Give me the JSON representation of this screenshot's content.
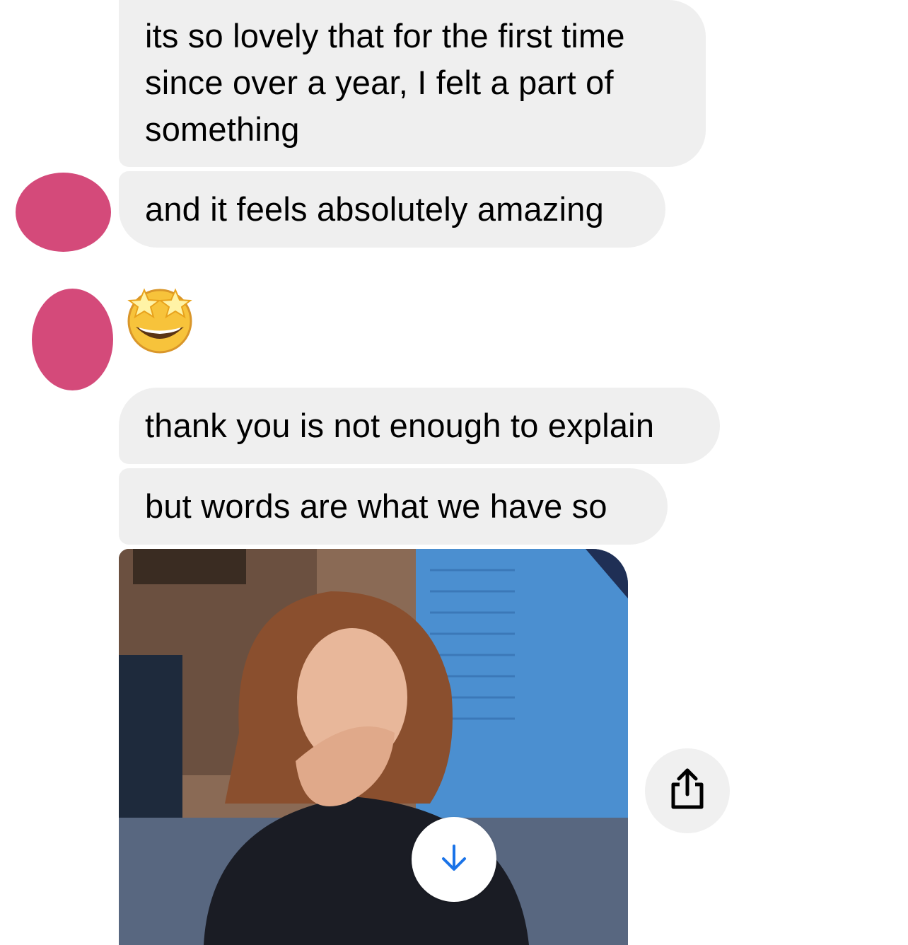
{
  "messages": [
    {
      "text": "its so lovely that for the first time since over a year, I felt a part of something"
    },
    {
      "text": "and it feels absolutely amazing"
    },
    {
      "emoji": "star-struck"
    },
    {
      "text": "thank you is not enough to explain"
    },
    {
      "text": "but words are what we have so"
    }
  ],
  "gif": {
    "subject": "woman blowing a kiss"
  },
  "icons": {
    "download": "download-arrow-icon",
    "share": "share-icon"
  },
  "colors": {
    "bubble": "#efefef",
    "avatar": "#d44a7a",
    "accent": "#1a73e8"
  }
}
